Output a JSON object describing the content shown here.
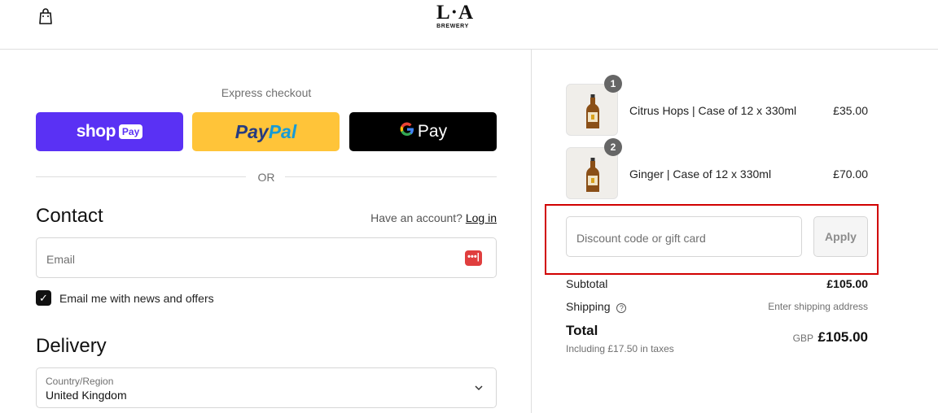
{
  "header": {
    "logo_main": "L·A",
    "logo_sub": "BREWERY"
  },
  "express": {
    "title": "Express checkout",
    "shop_word": "shop",
    "shop_pay": "Pay",
    "paypal_1": "Pay",
    "paypal_2": "Pal",
    "gpay_g": "G",
    "gpay_word": "Pay",
    "or": "OR"
  },
  "contact": {
    "title": "Contact",
    "have_account": "Have an account?",
    "login": "Log in",
    "email_placeholder": "Email",
    "newsletter_label": "Email me with news and offers",
    "newsletter_checked": true
  },
  "delivery": {
    "title": "Delivery",
    "country_label": "Country/Region",
    "country_value": "United Kingdom"
  },
  "cart": {
    "items": [
      {
        "qty": "1",
        "name": "Citrus Hops | Case of 12 x 330ml",
        "price": "£35.00"
      },
      {
        "qty": "2",
        "name": "Ginger | Case of 12 x 330ml",
        "price": "£70.00"
      }
    ],
    "discount_placeholder": "Discount code or gift card",
    "apply_label": "Apply",
    "subtotal_label": "Subtotal",
    "subtotal_value": "£105.00",
    "shipping_label": "Shipping",
    "shipping_value": "Enter shipping address",
    "total_label": "Total",
    "taxes_note": "Including £17.50 in taxes",
    "currency": "GBP",
    "total_value": "£105.00"
  },
  "colors": {
    "shop_pay": "#5a31f4",
    "paypal": "#ffc439",
    "gpay": "#000000",
    "highlight": "#d10000"
  }
}
